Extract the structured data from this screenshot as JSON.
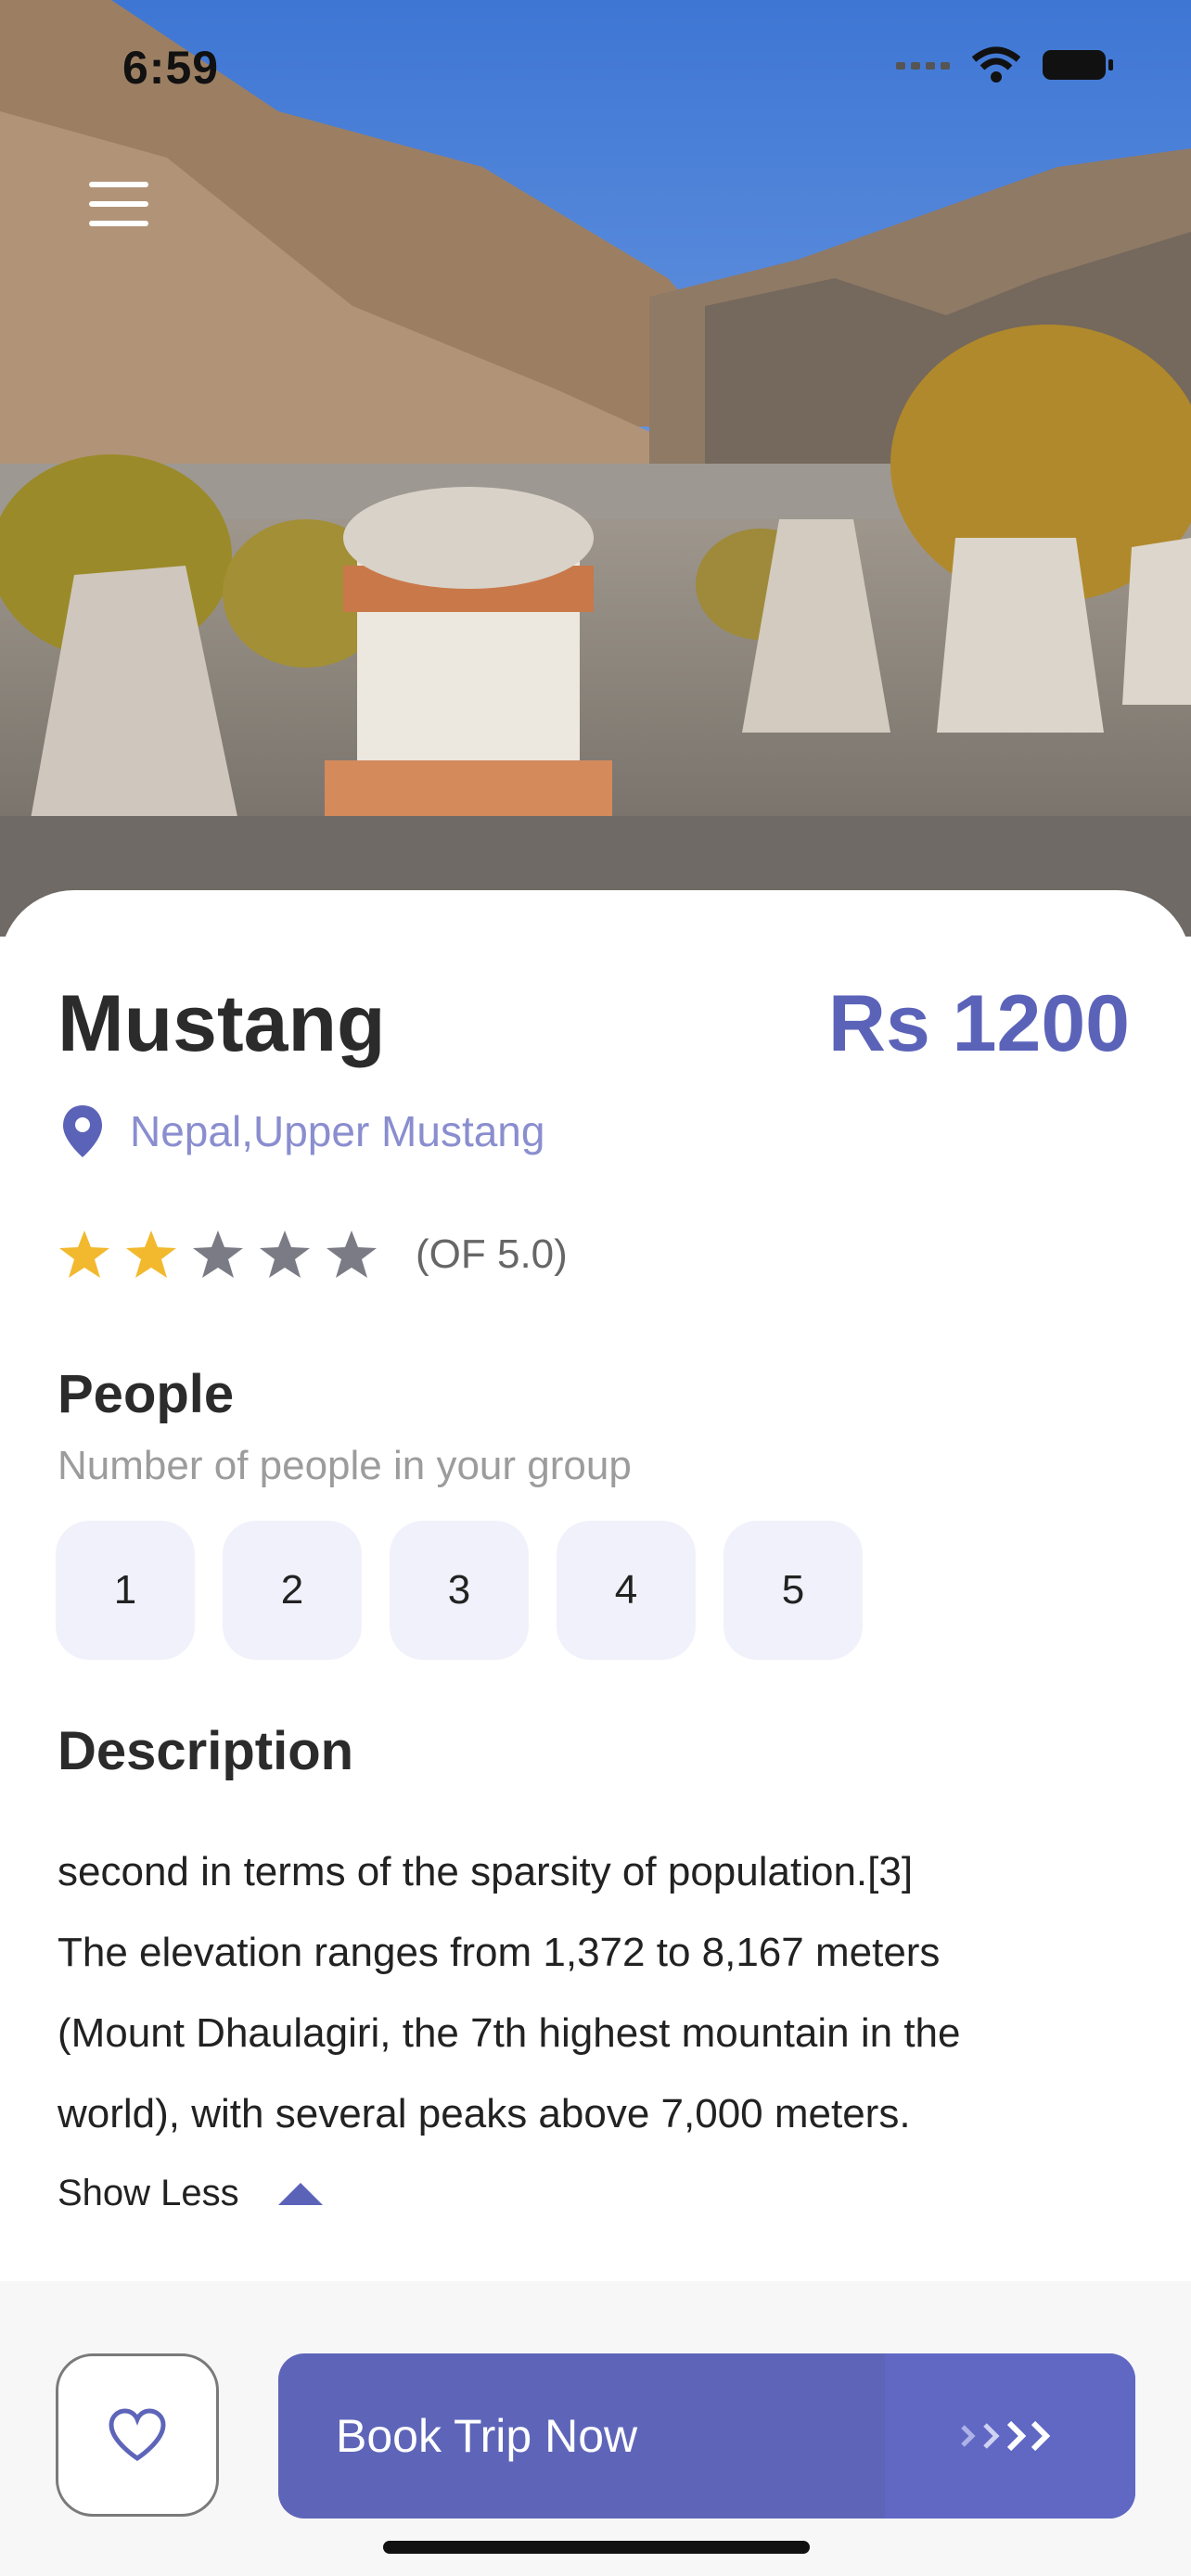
{
  "status_bar": {
    "time": "6:59"
  },
  "destination": {
    "title": "Mustang",
    "price": "Rs 1200",
    "location": "Nepal,Upper Mustang",
    "rating": {
      "stars_filled": 2,
      "stars_total": 5,
      "text": "(OF 5.0)"
    }
  },
  "people": {
    "heading": "People",
    "subtitle": "Number of people in your group",
    "options": [
      "1",
      "2",
      "3",
      "4",
      "5"
    ]
  },
  "description": {
    "heading": "Description",
    "lines": [
      "second in terms of the sparsity of population.[3]",
      "The elevation ranges from 1,372 to 8,167 meters",
      "(Mount Dhaulagiri, the 7th highest mountain in the",
      "world), with several peaks above 7,000 meters."
    ],
    "toggle_label": "Show Less"
  },
  "actions": {
    "book_label": "Book Trip Now"
  },
  "colors": {
    "accent": "#5e65b9",
    "star": "#f2b92e",
    "star_empty": "#7b7b86",
    "chip": "#f1f1fb"
  }
}
